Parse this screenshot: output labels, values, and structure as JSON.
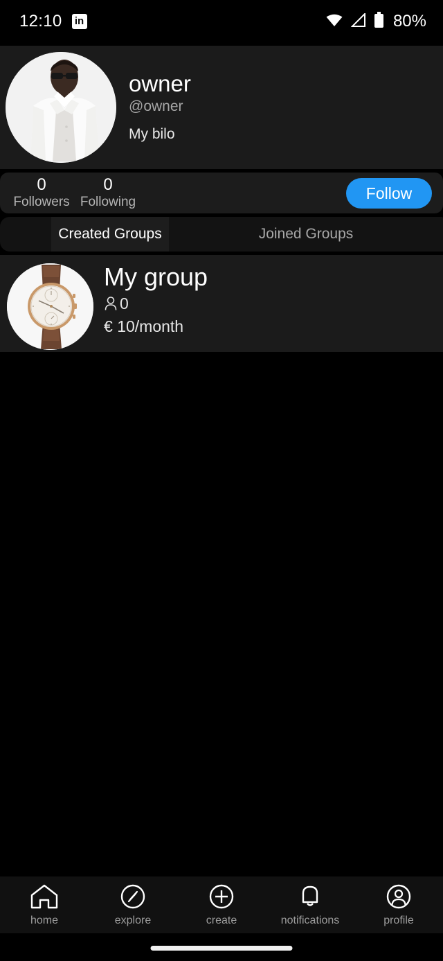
{
  "status_bar": {
    "time": "12:10",
    "app_icon": "linkedin-icon",
    "app_icon_label": "in",
    "wifi_icon": "wifi-icon",
    "signal_icon": "cellular-signal-icon",
    "battery_icon": "battery-icon",
    "battery_percent": "80%"
  },
  "profile": {
    "avatar_alt": "man-in-white-jacket-avatar",
    "name": "owner",
    "handle": "@owner",
    "bio": "My bilo"
  },
  "stats": {
    "followers_count": "0",
    "followers_label": "Followers",
    "following_count": "0",
    "following_label": "Following",
    "follow_button": "Follow",
    "follow_button_color": "#2196f3"
  },
  "tabs": {
    "selected": "Created Groups",
    "items": [
      {
        "label": "Created Groups",
        "active": true
      },
      {
        "label": "Joined Groups",
        "active": false
      }
    ]
  },
  "groups": [
    {
      "avatar_alt": "rose-gold-chronograph-watch",
      "name": "My group",
      "members_icon": "person-icon",
      "members_count": "0",
      "currency": "€",
      "price": "10/month"
    }
  ],
  "bottom_nav": {
    "items": [
      {
        "icon": "home-icon",
        "label": "home"
      },
      {
        "icon": "explore-compass-icon",
        "label": "explore"
      },
      {
        "icon": "create-plus-icon",
        "label": "create"
      },
      {
        "icon": "notifications-bell-icon",
        "label": "notifications"
      },
      {
        "icon": "profile-person-icon",
        "label": "profile"
      }
    ]
  }
}
